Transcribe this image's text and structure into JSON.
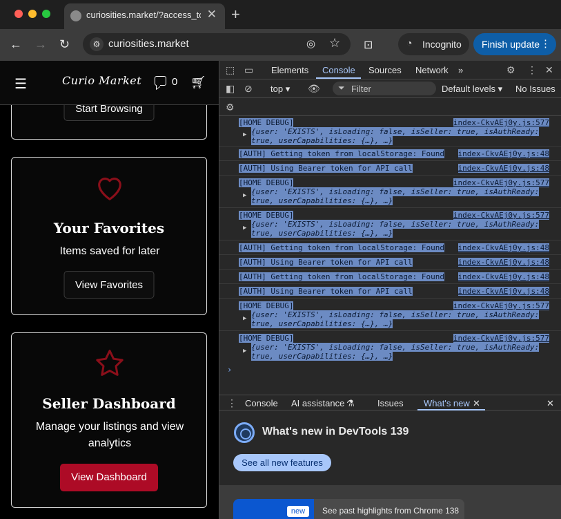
{
  "browser": {
    "tab_title": "curiosities.market/?access_to",
    "tab_close": "✕",
    "new_tab": "+",
    "url": "curiosities.market",
    "incognito_label": "Incognito",
    "update_label": "Finish update"
  },
  "site": {
    "logo": "Curio Market",
    "message_count": "0",
    "card1": {
      "button": "Start Browsing"
    },
    "card2": {
      "title": "Your Favorites",
      "subtitle": "Items saved for later",
      "button": "View Favorites"
    },
    "card3": {
      "title": "Seller Dashboard",
      "subtitle": "Manage your listings and view analytics",
      "button": "View Dashboard"
    },
    "colors": {
      "accent_red": "#ad0b26",
      "icon_red": "#8b0f1a"
    }
  },
  "devtools": {
    "tabs": [
      "Elements",
      "Console",
      "Sources",
      "Network"
    ],
    "more_tabs": "»",
    "context": "top",
    "filter_placeholder": "Filter",
    "levels": "Default levels",
    "issues": "No Issues",
    "logs": [
      {
        "text": "[HOME DEBUG]",
        "source": "index-CkvAEj0y.js:577",
        "obj1": "{user: 'EXISTS', isLoading: false, isSeller: true, isAuthReady:",
        "obj2": "true, userCapabilities: {…}, …}"
      },
      {
        "text": "[AUTH] Getting token from localStorage: Found",
        "source": "index-CkvAEj0y.js:48"
      },
      {
        "text": "[AUTH] Using Bearer token for API call",
        "source": "index-CkvAEj0y.js:48"
      },
      {
        "text": "[HOME DEBUG]",
        "source": "index-CkvAEj0y.js:577",
        "obj1": "{user: 'EXISTS', isLoading: false, isSeller: true, isAuthReady:",
        "obj2": "true, userCapabilities: {…}, …}"
      },
      {
        "text": "[HOME DEBUG]",
        "source": "index-CkvAEj0y.js:577",
        "obj1": "{user: 'EXISTS', isLoading: false, isSeller: true, isAuthReady:",
        "obj2": "true, userCapabilities: {…}, …}"
      },
      {
        "text": "[AUTH] Getting token from localStorage: Found",
        "source": "index-CkvAEj0y.js:48"
      },
      {
        "text": "[AUTH] Using Bearer token for API call",
        "source": "index-CkvAEj0y.js:48"
      },
      {
        "text": "[AUTH] Getting token from localStorage: Found",
        "source": "index-CkvAEj0y.js:48"
      },
      {
        "text": "[AUTH] Using Bearer token for API call",
        "source": "index-CkvAEj0y.js:48"
      },
      {
        "text": "[HOME DEBUG]",
        "source": "index-CkvAEj0y.js:577",
        "obj1": "{user: 'EXISTS', isLoading: false, isSeller: true, isAuthReady:",
        "obj2": "true, userCapabilities: {…}, …}"
      },
      {
        "text": "[HOME DEBUG]",
        "source": "index-CkvAEj0y.js:577",
        "obj1": "{user: 'EXISTS', isLoading: false, isSeller: true, isAuthReady:",
        "obj2": "true, userCapabilities: {…}, …}"
      }
    ],
    "drawer_tabs": {
      "console": "Console",
      "ai": "AI assistance",
      "issues": "Issues",
      "whats_new": "What's new"
    },
    "whats_new_title": "What's new in DevTools 139",
    "see_all": "See all new features",
    "badge_new": "new",
    "highlights_text": "See past highlights from Chrome 138"
  }
}
